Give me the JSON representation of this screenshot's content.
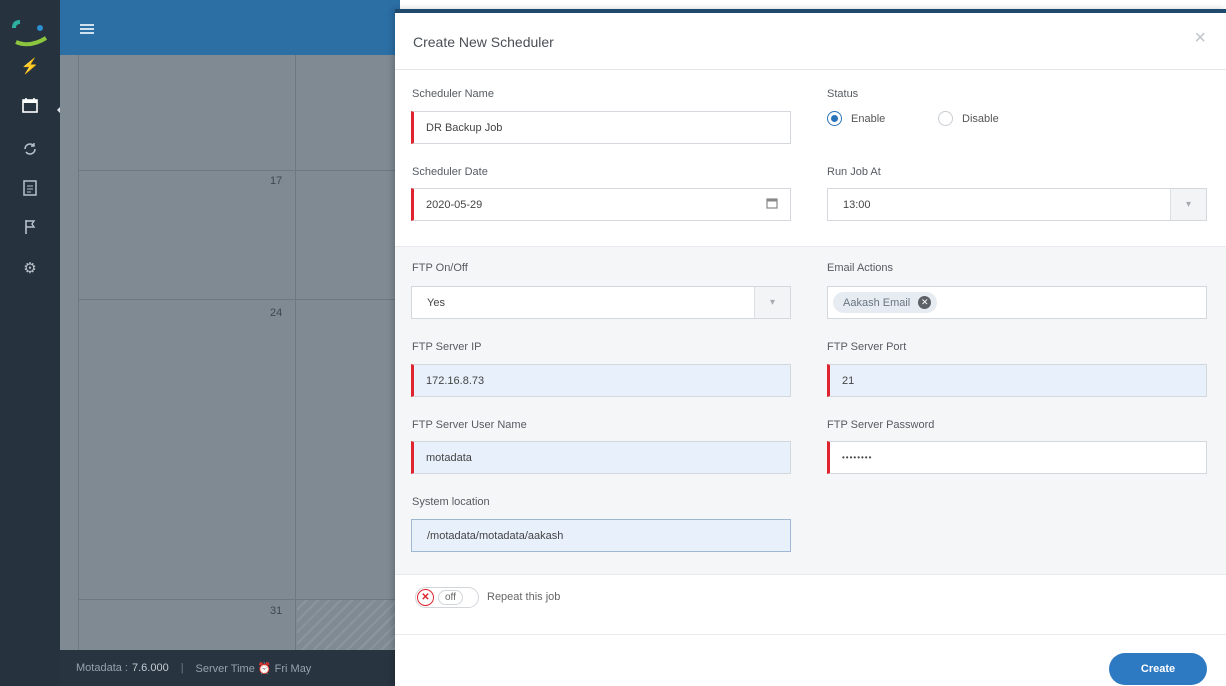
{
  "app": {
    "footer": {
      "product": "Motadata : ",
      "version": "7.6.000",
      "server_time": "Server Time ⏰ Fri May"
    },
    "calendar": {
      "days": [
        "17",
        "24",
        "31"
      ]
    }
  },
  "modal": {
    "title": "Create New Scheduler",
    "close_glyph": "×",
    "scheduler_name": {
      "label": "Scheduler Name",
      "value": "DR Backup Job"
    },
    "status": {
      "label": "Status",
      "options": [
        "Enable",
        "Disable"
      ],
      "selected": "Enable"
    },
    "scheduler_date": {
      "label": "Scheduler Date",
      "value": "2020-05-29"
    },
    "run_job_at": {
      "label": "Run Job At",
      "value": "13:00"
    },
    "ftp_onoff": {
      "label": "FTP On/Off",
      "value": "Yes"
    },
    "email_actions": {
      "label": "Email Actions",
      "tags": [
        "Aakash Email"
      ]
    },
    "ftp_server_ip": {
      "label": "FTP Server IP",
      "value": "172.16.8.73"
    },
    "ftp_server_port": {
      "label": "FTP Server Port",
      "value": "21"
    },
    "ftp_user_name": {
      "label": "FTP Server User Name",
      "value": "motadata"
    },
    "ftp_password": {
      "label": "FTP Server Password",
      "value": "••••••••"
    },
    "system_location": {
      "label": "System location",
      "value": "/motadata/motadata/aakash"
    },
    "repeat": {
      "toggle_state": "off",
      "label": "Repeat this job"
    },
    "create_label": "Create"
  },
  "colors": {
    "primary": "#2e7ac2",
    "required": "#e0242f",
    "header": "#2b6fa5",
    "sidebar": "#26323d"
  }
}
